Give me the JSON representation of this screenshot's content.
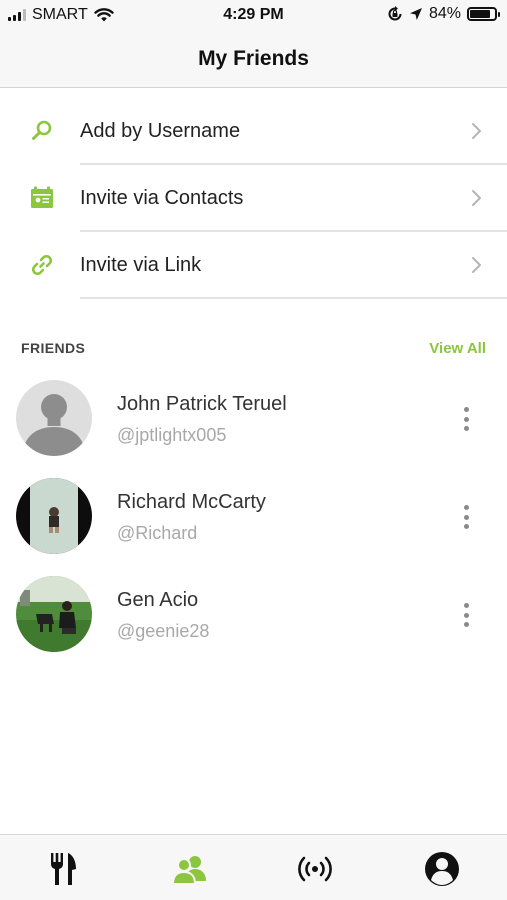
{
  "status_bar": {
    "carrier": "SMART",
    "time": "4:29 PM",
    "battery_percent": "84%",
    "battery_level": 0.84,
    "icons": [
      "signal-icon",
      "wifi-icon",
      "orientation-lock-icon",
      "location-arrow-icon",
      "battery-icon"
    ]
  },
  "header": {
    "title": "My Friends"
  },
  "actions": [
    {
      "label": "Add by Username",
      "icon": "search-icon"
    },
    {
      "label": "Invite via Contacts",
      "icon": "contacts-icon"
    },
    {
      "label": "Invite via Link",
      "icon": "link-icon"
    }
  ],
  "friends_section": {
    "title": "FRIENDS",
    "view_all": "View All",
    "items": [
      {
        "name": "John Patrick Teruel",
        "handle": "@jptlightx005",
        "avatar": "default-avatar"
      },
      {
        "name": "Richard McCarty",
        "handle": "@Richard",
        "avatar": "photo-avatar"
      },
      {
        "name": "Gen Acio",
        "handle": "@geenie28",
        "avatar": "photo-avatar"
      }
    ]
  },
  "tab_bar": {
    "tabs": [
      {
        "icon": "fork-knife-icon",
        "active": false
      },
      {
        "icon": "friends-icon",
        "active": true
      },
      {
        "icon": "broadcast-icon",
        "active": false
      },
      {
        "icon": "profile-icon",
        "active": false
      }
    ]
  },
  "colors": {
    "accent": "#8cc63f",
    "text_primary": "#222222",
    "text_secondary": "#a8a8a8",
    "bar_background": "#f7f7f7"
  }
}
